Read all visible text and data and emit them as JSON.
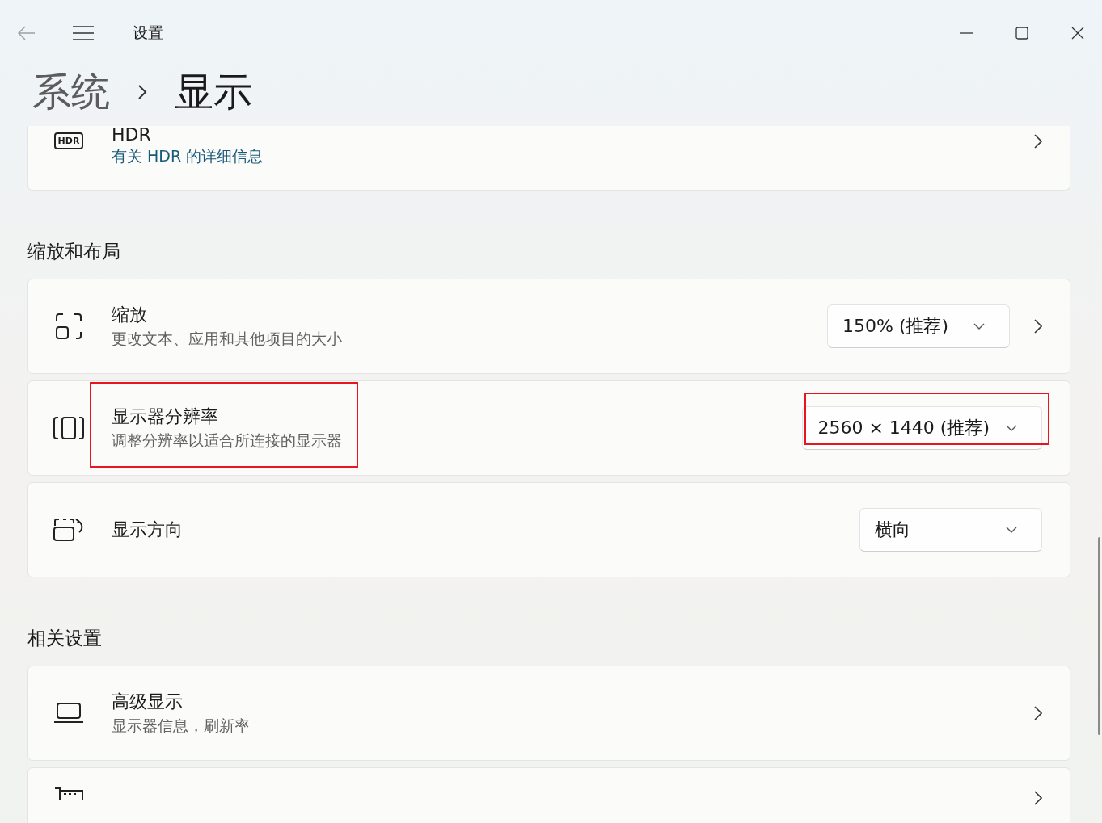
{
  "window": {
    "title": "设置"
  },
  "breadcrumb": [
    {
      "label": "系统",
      "current": false
    },
    {
      "label": "显示",
      "current": true
    }
  ],
  "items": [
    {
      "kind": "hdr",
      "badge": "HDR",
      "title": "HDR",
      "link": "有关 HDR 的详细信息",
      "highlighted": false,
      "chevron": true
    },
    {
      "kind": "heading",
      "text": "缩放和布局"
    },
    {
      "kind": "scaling",
      "title": "缩放",
      "subtitle": "更改文本、应用和其他项目的大小",
      "highlighted": false,
      "dropdown": {
        "value": "150% (推荐)",
        "highlighted": false
      },
      "chevron": true
    },
    {
      "kind": "resolution",
      "title": "显示器分辨率",
      "subtitle": "调整分辨率以适合所连接的显示器",
      "highlighted": true,
      "dropdown": {
        "value": "2560 × 1440 (推荐)",
        "highlighted": true
      },
      "chevron": false
    },
    {
      "kind": "orientation",
      "title": "显示方向",
      "highlighted": false,
      "dropdown": {
        "value": "横向",
        "highlighted": false
      },
      "chevron": false
    },
    {
      "kind": "heading",
      "text": "相关设置"
    },
    {
      "kind": "advanced",
      "title": "高级显示",
      "subtitle": "显示器信息，刷新率",
      "highlighted": false,
      "chevron": true
    },
    {
      "kind": "adapter",
      "chevron": true
    }
  ]
}
